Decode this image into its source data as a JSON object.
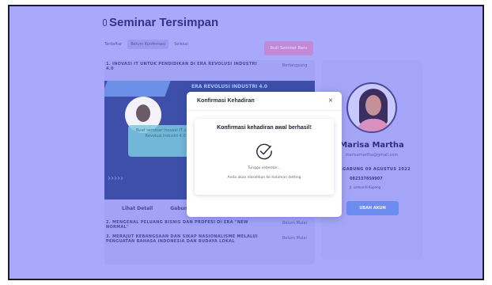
{
  "page": {
    "title": "Seminar Tersimpan",
    "tabs": [
      "Terdaftar",
      "Belum Konfirmasi",
      "Selesai"
    ],
    "new_button": "Ikuti Seminar Baru"
  },
  "seminars": [
    {
      "title": "1. INOVASI IT UNTUK PENDIDIKAN DI ERA REVOLUSI INDUSTRI 4.0",
      "status": "Berlangsung"
    },
    {
      "title": "2. MENGENAL PELUANG BISNIS DAN PROFESI DI ERA \"NEW NORMAL\"",
      "status": "Belum Mulai"
    },
    {
      "title": "3. MERAJUT KEBANGSAAN DAN SIKAP NASIONALISME MELALUI PENGUATAN BAHASA INDONESIA DAN BUDAYA LOKAL",
      "status": "Belum Mulai"
    }
  ],
  "banner": {
    "title": "ERA REVOLUSI INDUSTRI 4.0",
    "notice": "Buat seminar Inovasi IT untuk pendidikan di Era Revolusi Industri 4.0 baru berlangsung",
    "social": "@leapr_uni"
  },
  "card_actions": {
    "detail": "Lihat Detail",
    "join": "Gabung"
  },
  "profile": {
    "name": "Marisa Martha",
    "email": "marisamartha@gmail.com",
    "joined": "BERGABUNG 09 AGUSTUS 2022",
    "phone": "082337859907",
    "address": "Jl. Lemonilli Kupang",
    "edit_button": "UBAH AKUN"
  },
  "modal": {
    "title": "Konfirmasi Kehadiran",
    "close": "×",
    "heading": "Konfirmasi kehadiran awal berhasil!",
    "wait": "Tunggu sebentar...",
    "redirect": "Anda akan diarahkan ke halaman detting"
  },
  "colors": {
    "overlay": "#a9a9fb",
    "accent": "#6d8cf0",
    "pink": "#c08ad8"
  }
}
